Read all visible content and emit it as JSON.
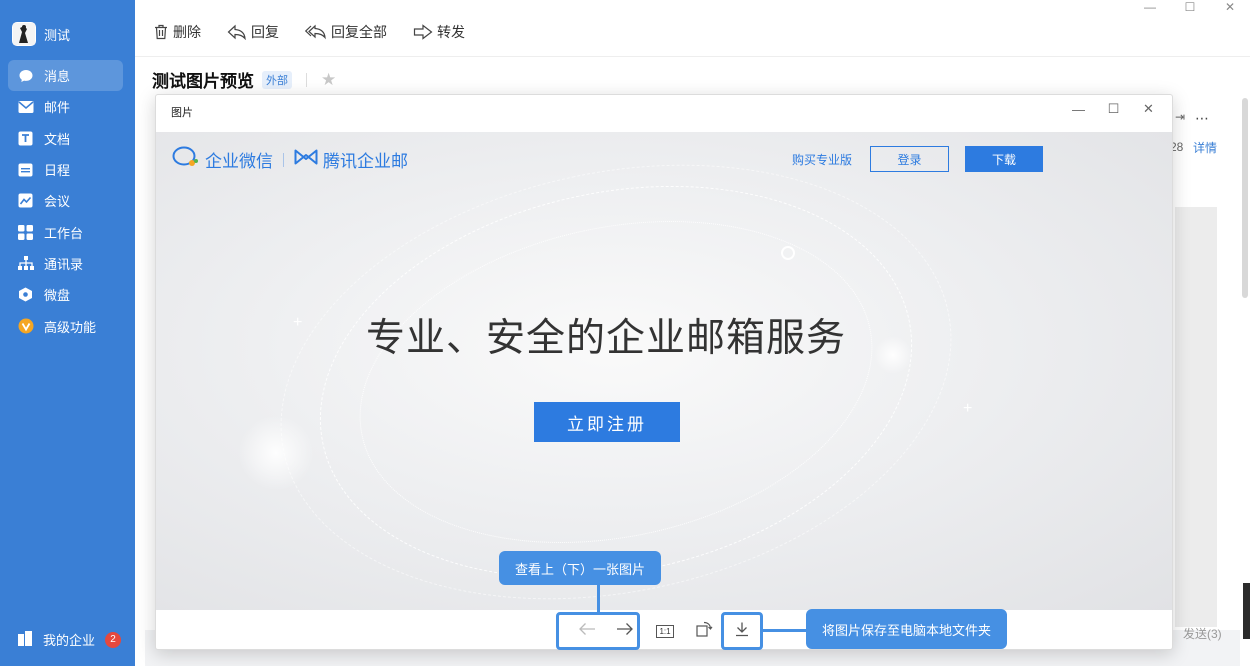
{
  "profile": {
    "name": "测试"
  },
  "nav": {
    "items": [
      {
        "label": "消息",
        "icon": "chat-bubble-icon"
      },
      {
        "label": "邮件",
        "icon": "mail-icon"
      },
      {
        "label": "文档",
        "icon": "doc-icon"
      },
      {
        "label": "日程",
        "icon": "calendar-icon"
      },
      {
        "label": "会议",
        "icon": "meeting-icon"
      },
      {
        "label": "工作台",
        "icon": "grid-icon"
      },
      {
        "label": "通讯录",
        "icon": "org-icon"
      },
      {
        "label": "微盘",
        "icon": "disk-icon"
      },
      {
        "label": "高级功能",
        "icon": "vip-icon"
      }
    ],
    "company_label": "我的企业",
    "company_badge": "2"
  },
  "toolbar": {
    "delete": "删除",
    "reply": "回复",
    "reply_all": "回复全部",
    "forward": "转发"
  },
  "mail": {
    "subject": "测试图片预览",
    "tag": "外部",
    "detail_link": "详情",
    "partial_number": "28",
    "send_label": "发送(3)"
  },
  "dialog": {
    "title": "图片"
  },
  "preview": {
    "logo_left": "企业微信",
    "logo_right": "腾讯企业邮",
    "buy_pro": "购买专业版",
    "login": "登录",
    "download": "下载",
    "headline": "专业、安全的企业邮箱服务",
    "signup": "立即注册"
  },
  "viewer": {
    "actual_size_label": "1:1"
  },
  "callouts": {
    "nav_hint": "查看上（下）一张图片",
    "save_hint": "将图片保存至电脑本地文件夹"
  },
  "colors": {
    "sidebar": "#3a7fd5",
    "accent": "#2d7be0",
    "callout": "#4690e3",
    "badge": "#e5483d"
  }
}
